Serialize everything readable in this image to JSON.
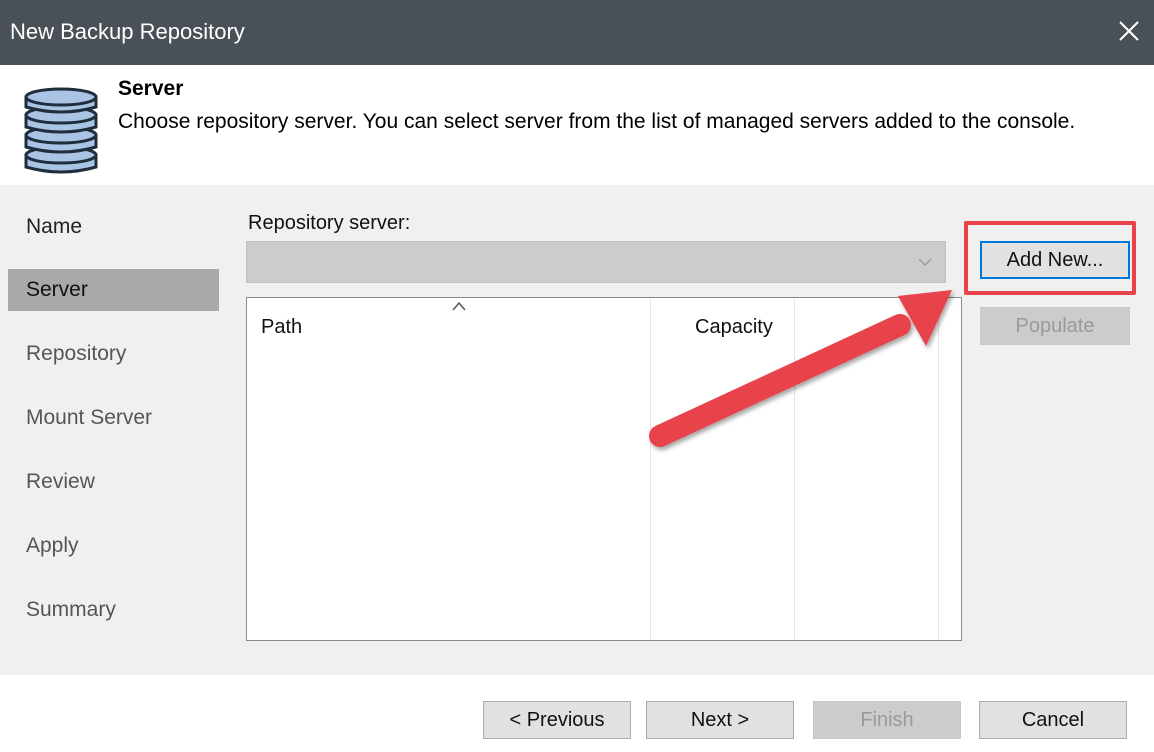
{
  "window": {
    "title": "New Backup Repository"
  },
  "header": {
    "title": "Server",
    "description": "Choose repository server. You can select server from the list of managed servers added to the console."
  },
  "nav": {
    "items": [
      {
        "label": "Name",
        "state": "done"
      },
      {
        "label": "Server",
        "state": "active"
      },
      {
        "label": "Repository",
        "state": "pending"
      },
      {
        "label": "Mount Server",
        "state": "pending"
      },
      {
        "label": "Review",
        "state": "pending"
      },
      {
        "label": "Apply",
        "state": "pending"
      },
      {
        "label": "Summary",
        "state": "pending"
      }
    ]
  },
  "content": {
    "repository_server_label": "Repository server:",
    "repository_server_value": "",
    "grid_columns": [
      "Path",
      "Capacity"
    ],
    "add_new_label": "Add New...",
    "populate_label": "Populate"
  },
  "footer": {
    "previous_label": "< Previous",
    "next_label": "Next >",
    "finish_label": "Finish",
    "cancel_label": "Cancel"
  },
  "colors": {
    "titlebar": "#4a5057",
    "highlight": "#e8434b",
    "focus_border": "#0078d7",
    "nav_active": "#a9a9a9",
    "panel_bg": "#f0f0f0"
  },
  "icons": [
    "close-icon",
    "database-icon",
    "chevron-down-icon",
    "sort-up-icon",
    "annotation-arrow"
  ]
}
